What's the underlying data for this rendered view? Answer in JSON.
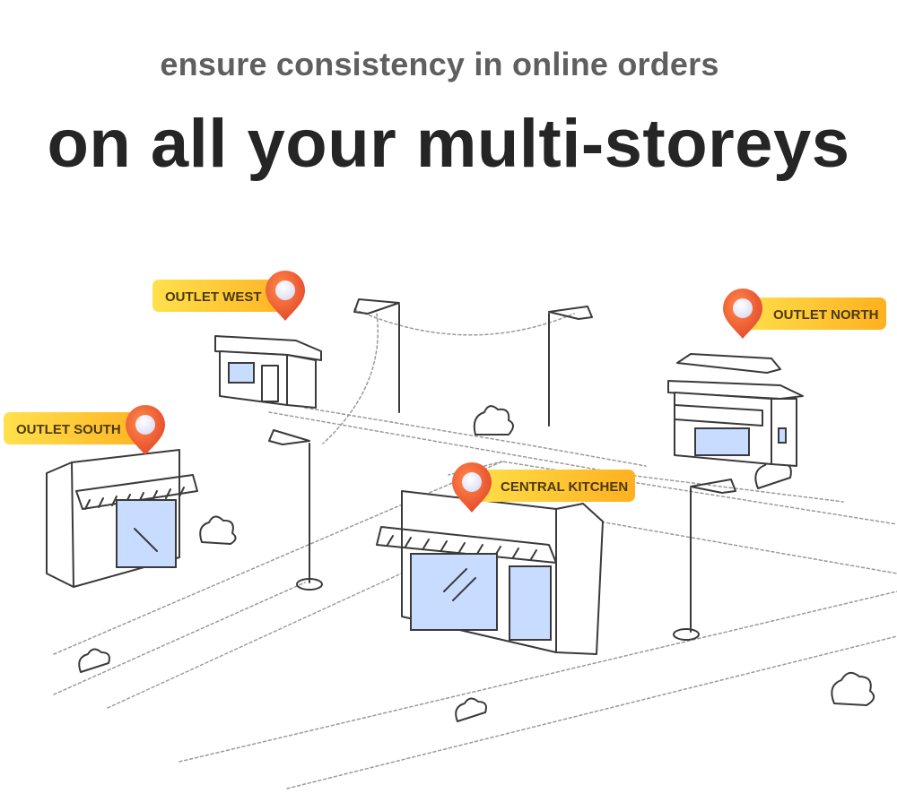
{
  "header": {
    "subtitle": "ensure consistency in online orders",
    "title": "on all your multi-storeys"
  },
  "locations": {
    "west": {
      "label": "OUTLET WEST"
    },
    "north": {
      "label": "OUTLET NORTH"
    },
    "south": {
      "label": "OUTLET SOUTH"
    },
    "central": {
      "label": "CENTRAL KITCHEN"
    }
  },
  "colors": {
    "label_gradient_start": "#ffe14d",
    "label_gradient_end": "#ffb020",
    "pin": "#f2643a",
    "glass": "#c7dcff",
    "sketch": "#3a3a3a"
  },
  "icons": [
    "location-pin-icon",
    "store-icon",
    "street-lamp-icon",
    "bush-icon"
  ]
}
